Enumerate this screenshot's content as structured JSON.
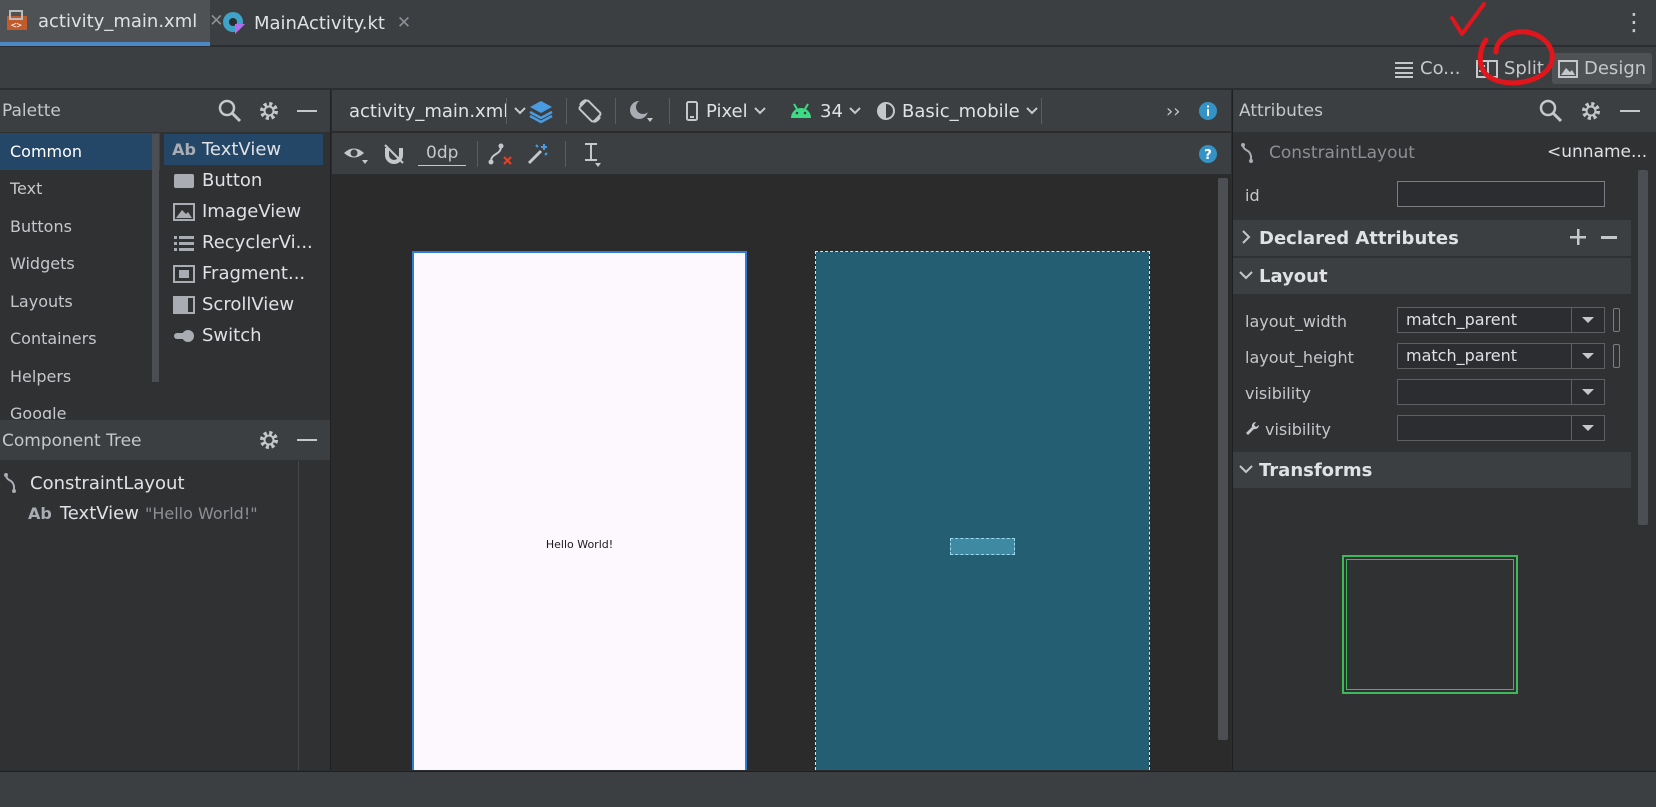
{
  "tabs": [
    {
      "label": "activity_main.xml",
      "active": true
    },
    {
      "label": "MainActivity.kt",
      "active": false
    }
  ],
  "tab_close_glyph": "✕",
  "more_glyph": "⋮",
  "modes": {
    "code_label": "Co...",
    "split_label": "Split",
    "design_label": "Design",
    "annotation_color": "#e0161c"
  },
  "palette": {
    "title": "Palette",
    "categories": [
      "Common",
      "Text",
      "Buttons",
      "Widgets",
      "Layouts",
      "Containers",
      "Helpers",
      "Google"
    ],
    "items": [
      {
        "label": "TextView",
        "icon": "textview-icon",
        "glyph": "Ab"
      },
      {
        "label": "Button",
        "icon": "button-icon"
      },
      {
        "label": "ImageView",
        "icon": "imageview-icon"
      },
      {
        "label": "RecyclerVi...",
        "icon": "recyclerview-icon"
      },
      {
        "label": "Fragment...",
        "icon": "fragment-icon"
      },
      {
        "label": "ScrollView",
        "icon": "scrollview-icon"
      },
      {
        "label": "Switch",
        "icon": "switch-icon"
      }
    ]
  },
  "component_tree": {
    "title": "Component Tree",
    "root": "ConstraintLayout",
    "child_glyph": "Ab",
    "child": "TextView",
    "child_text": "\"Hello World!\""
  },
  "editor": {
    "file": "activity_main.xml",
    "device": "Pixel",
    "api": "34",
    "theme": "Basic_mobile",
    "margin": "0dp",
    "overflow": "››"
  },
  "preview": {
    "hello_text": "Hello World!",
    "design_bg": "#fdf7fe",
    "blueprint_bg": "#245e72"
  },
  "attributes": {
    "title": "Attributes",
    "component": "ConstraintLayout",
    "component_id": "<unname...",
    "id_label": "id",
    "id_value": "",
    "declared_title": "Declared Attributes",
    "layout_title": "Layout",
    "rows": [
      {
        "label": "layout_width",
        "value": "match_parent"
      },
      {
        "label": "layout_height",
        "value": "match_parent"
      },
      {
        "label": "visibility",
        "value": ""
      },
      {
        "label": "visibility",
        "value": "",
        "tool": true
      }
    ],
    "transforms_title": "Transforms"
  },
  "accent": "#4a88c7"
}
